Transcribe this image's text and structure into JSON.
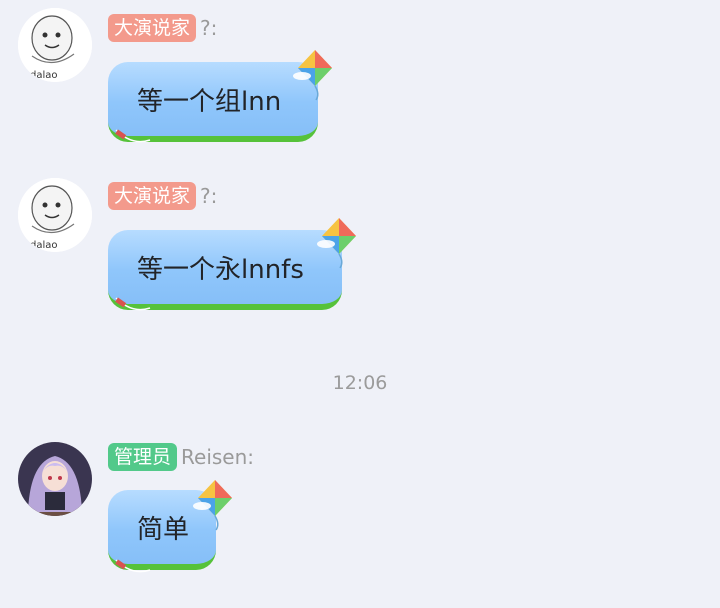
{
  "messages": [
    {
      "badge": "大演说家",
      "sender": "?:",
      "avatar_text": "dalao",
      "text": "等一个组lnn"
    },
    {
      "badge": "大演说家",
      "sender": "?:",
      "avatar_text": "dalao",
      "text": "等一个永lnnfs"
    },
    {
      "badge": "管理员",
      "sender": "Reisen:",
      "text": "简单"
    }
  ],
  "timestamp": "12:06",
  "colors": {
    "background": "#eff1f8",
    "badge_member": "#f39a8c",
    "badge_admin": "#52c98a",
    "bubble": "#8fc6fb",
    "bubble_grass": "#56c23a"
  }
}
